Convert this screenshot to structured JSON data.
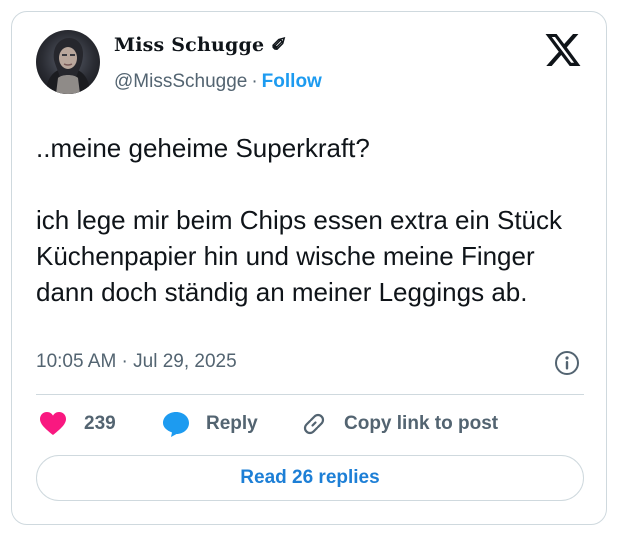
{
  "author": {
    "display_name": "Miss Schugge ✐",
    "handle": "@MissSchugge",
    "separator": "·",
    "follow_label": "Follow"
  },
  "tweet": {
    "text": "..meine geheime Superkraft?\n\nich lege mir beim Chips essen extra ein Stück Küchenpapier hin und wische meine Finger dann doch ständig an meiner Leggings ab.",
    "timestamp": "10:05 AM · Jul 29, 2025"
  },
  "actions": {
    "like_count": "239",
    "reply_label": "Reply",
    "copy_label": "Copy link to post"
  },
  "read_replies_label": "Read 26 replies",
  "icons": {
    "brand": "x-logo-icon",
    "info": "info-icon",
    "like": "heart-icon",
    "reply": "speech-bubble-icon",
    "copy": "link-icon"
  },
  "colors": {
    "accent": "#1d9bf0",
    "heart": "#f91880",
    "muted": "#536471",
    "border": "#cfd9de"
  }
}
